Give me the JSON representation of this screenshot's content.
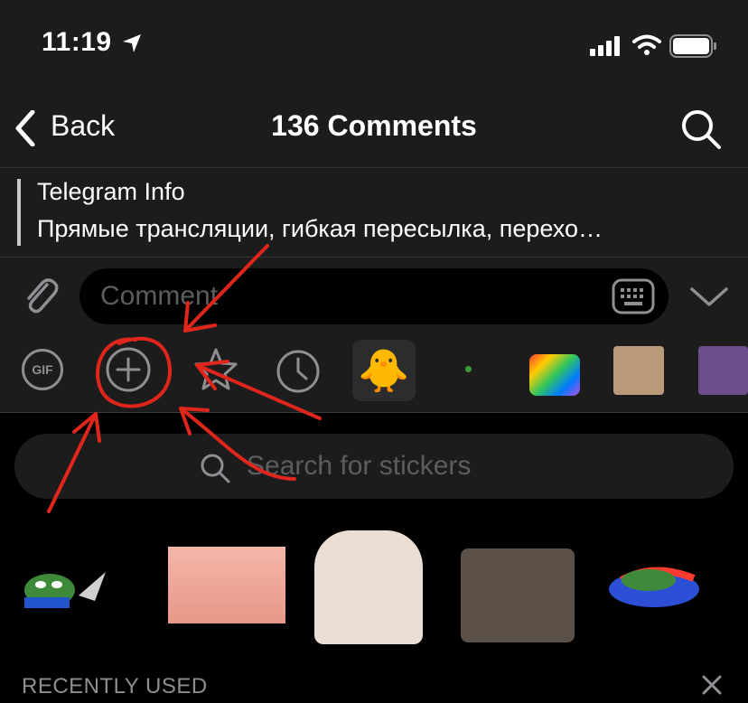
{
  "status_bar": {
    "time": "11:19"
  },
  "nav": {
    "back_label": "Back",
    "title": "136 Comments"
  },
  "reply": {
    "title": "Telegram Info",
    "text": "Прямые трансляции, гибкая пересылка, перехо…"
  },
  "input": {
    "placeholder": "Comment"
  },
  "sticker_tabs": {
    "gif_label": "GIF",
    "duck": "🐥"
  },
  "sticker_search": {
    "placeholder": "Search for stickers"
  },
  "section": {
    "recently_used": "RECENTLY USED"
  },
  "colors": {
    "panel": "#1c1c1d",
    "background": "#000000",
    "annotation": "#e0261c",
    "secondary": "#8e8e93"
  }
}
